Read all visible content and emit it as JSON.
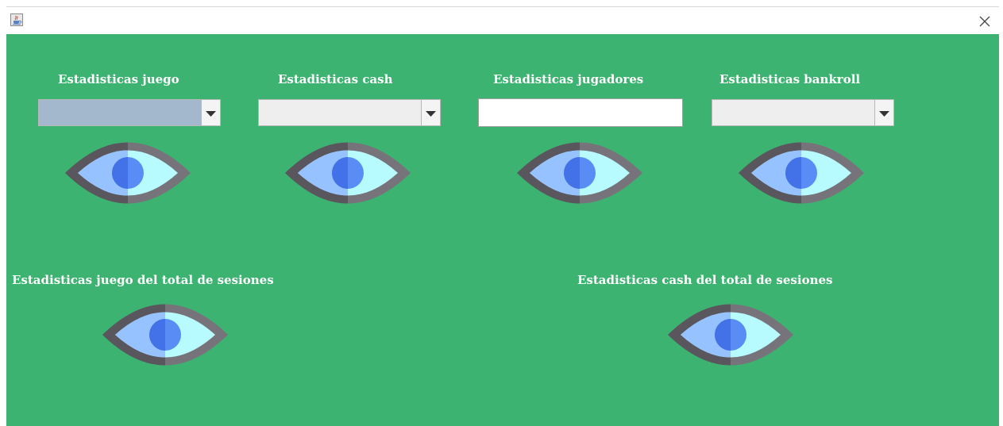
{
  "window": {
    "app_icon": "java-cup-icon",
    "close_icon": "close-icon"
  },
  "panel": {
    "background": "#3db371",
    "top_row": [
      {
        "label": "Estadisticas juego",
        "control": "combo",
        "icon": "eye-icon"
      },
      {
        "label": "Estadisticas cash",
        "control": "combo",
        "icon": "eye-icon"
      },
      {
        "label": "Estadisticas jugadores",
        "control": "text-field",
        "value": "",
        "icon": "eye-icon"
      },
      {
        "label": "Estadisticas bankroll",
        "control": "combo",
        "icon": "eye-icon"
      }
    ],
    "bottom_row": [
      {
        "label": "Estadisticas juego del total de sesiones",
        "icon": "eye-icon"
      },
      {
        "label": "Estadisticas cash del total de sesiones",
        "icon": "eye-icon"
      }
    ]
  },
  "colors": {
    "eye_outline": "#5f5d63",
    "eye_iris_light": "#96c2ff",
    "eye_sclera": "#b8fbff",
    "eye_pupil": "#4d7cf0"
  }
}
